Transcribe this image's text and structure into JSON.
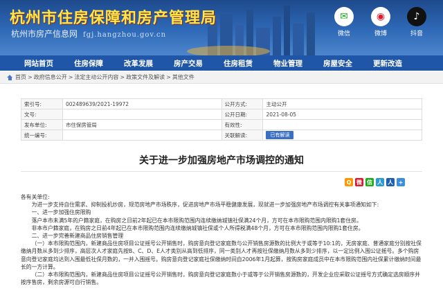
{
  "header": {
    "title": "杭州市住房保障和房产管理局",
    "subtitle": "杭州市房产信息网",
    "domain": "fgj.hangzhou.gov.cn",
    "social": [
      {
        "label": "微信",
        "icon": "wechat-icon",
        "glyph": "✉"
      },
      {
        "label": "微博",
        "icon": "weibo-icon",
        "glyph": "◉"
      },
      {
        "label": "抖音",
        "icon": "douyin-icon",
        "glyph": "♪"
      }
    ]
  },
  "nav": [
    "网站首页",
    "住房保障",
    "改革发展",
    "房产交易",
    "住房租赁",
    "物业管理",
    "房屋安全",
    "更新改造"
  ],
  "breadcrumb": [
    "首页",
    "政府信息公开",
    "法定主动公开内容",
    "政策文件及解读",
    "其他文件"
  ],
  "meta": {
    "rows": [
      {
        "k1": "索引号:",
        "v1": "002489639/2021-19972",
        "k2": "公开方式:",
        "v2": "主动公开"
      },
      {
        "k1": "文号:",
        "v1": "",
        "k2": "公开日期:",
        "v2": "2021-08-05"
      },
      {
        "k1": "发布单位:",
        "v1": "市住保房管局",
        "k2": "有效性:",
        "v2": ""
      },
      {
        "k1": "统一编号:",
        "v1": "",
        "k2": "关联解读:",
        "v2": ""
      }
    ],
    "search_button": "已有解读"
  },
  "article": {
    "title": "关于进一步加强房地产市场调控的通知",
    "greeting": "各有关单位:",
    "paragraphs": [
      "为进一步支持自住需求、抑制投机炒房，规范房地产市场秩序，促进房地产市场平稳健康发展，现就进一步加强房地产市场调控有关事项通知如下:",
      "一、进一步加强住房限购",
      "落户本市未满5年的户籍家庭，在购房之日前2年起已在本市限购范围内连续缴纳城镇社保满24个月，方可在本市限购范围内限购1套住房。",
      "非本市户籍家庭，在购房之日前4年起已在本市限购范围内连续缴纳城镇社保或个人所得税满48个月，方可在本市限购范围内限购1套住房。",
      "二、进一步完善新建商品住房销售管理",
      "（一）本市限购范围内，新建商品住房项目公证摇号公开销售时，购房意向登记家庭数与公开销售房源数的比例大于或等于10:1的，无房家庭、普通家庭分别按社保缴纳月数从多到少排序，高层次人才家庭先按B、C、D、E人才类别从高到低排序，同一类别人才再按社保缴纳月数从多到少排序，以一定比例入围公证摇号。多个购房意向登记家庭均达到入围最低社保月数的，一并入围摇号。购房意向登记家庭社保缴纳时间自2006年1月起算，按购房家庭成员中在本市限购范围内社保累计缴纳时间最长的一方计算。",
      "（二）本市限购范围内，新建商品住房项目公证摇号公开销售时，购房意向登记家庭数小于或等于公开销售房源数的，开发企业应采取公证摇号方式确定选房顺序并按序售房，剩余房源可自行销售。"
    ]
  },
  "share": [
    "Q",
    "微",
    "信",
    "人",
    "人",
    "+"
  ],
  "colors": {
    "banner": "#2f6ab8",
    "nav": "#1f56a8",
    "title_yellow": "#ffe64a"
  }
}
